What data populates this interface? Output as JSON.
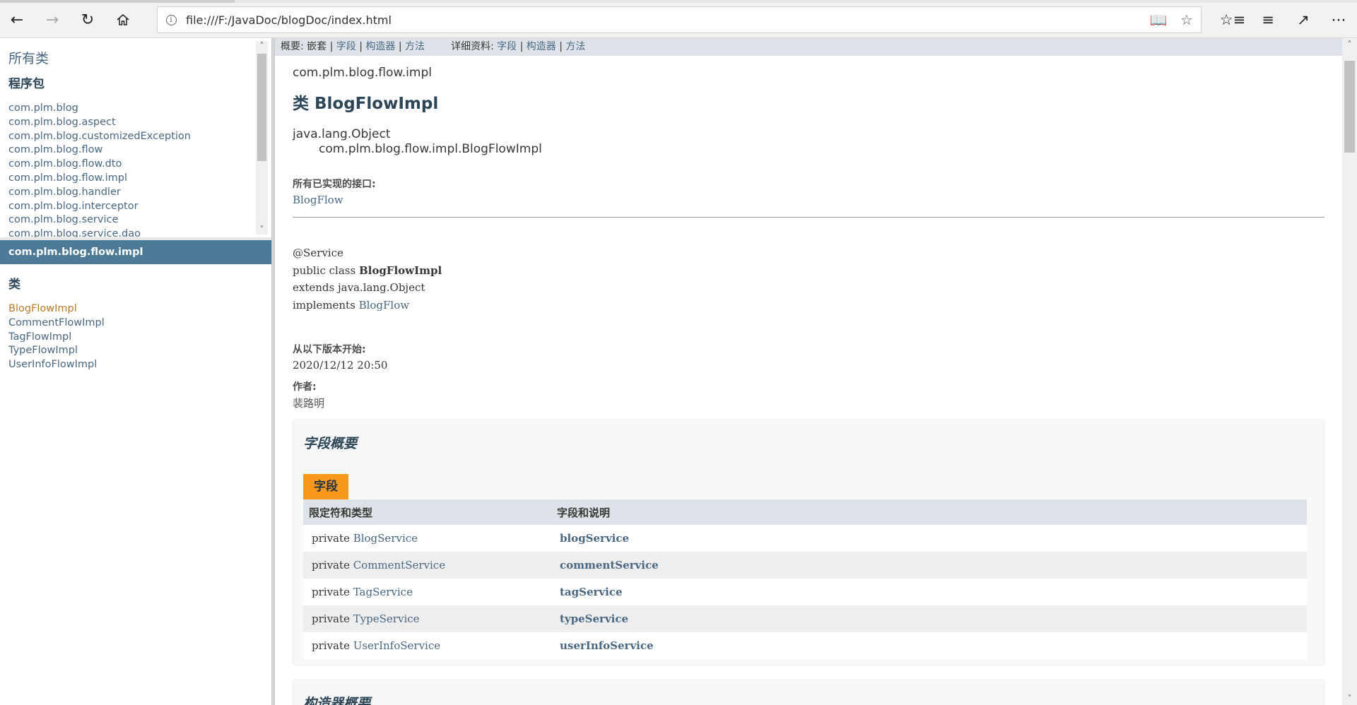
{
  "browser": {
    "url": "file:///F:/JavaDoc/blogDoc/index.html"
  },
  "package_frame": {
    "all_classes_link": "所有类",
    "heading": "程序包",
    "packages": [
      "com.plm.blog",
      "com.plm.blog.aspect",
      "com.plm.blog.customizedException",
      "com.plm.blog.flow",
      "com.plm.blog.flow.dto",
      "com.plm.blog.flow.impl",
      "com.plm.blog.handler",
      "com.plm.blog.interceptor",
      "com.plm.blog.service",
      "com.plm.blog.service.dao"
    ]
  },
  "class_frame": {
    "package_name": "com.plm.blog.flow.impl",
    "heading": "类",
    "classes": [
      "BlogFlowImpl",
      "CommentFlowImpl",
      "TagFlowImpl",
      "TypeFlowImpl",
      "UserInfoFlowImpl"
    ],
    "active_class": "BlogFlowImpl"
  },
  "subnav": {
    "summary_label": "概要:",
    "nested": "嵌套",
    "sep": "|",
    "field": "字段",
    "constructor": "构造器",
    "method": "方法",
    "detail_label": "详细资料:"
  },
  "content": {
    "package_name": "com.plm.blog.flow.impl",
    "class_title": "类 BlogFlowImpl",
    "inheritance_parent": "java.lang.Object",
    "inheritance_child": "com.plm.blog.flow.impl.BlogFlowImpl",
    "interfaces_label": "所有已实现的接口:",
    "interfaces_value": "BlogFlow",
    "signature": {
      "annotation": "@Service",
      "decl_prefix": "public class ",
      "class_name": "BlogFlowImpl",
      "extends_line": "extends java.lang.Object",
      "implements_prefix": "implements ",
      "implements_value": "BlogFlow"
    },
    "since_label": "从以下版本开始:",
    "since_value": "2020/12/12 20:50",
    "author_label": "作者:",
    "author_value": "裴路明",
    "field_summary": {
      "title": "字段概要",
      "caption": "字段",
      "columns": [
        "限定符和类型",
        "字段和说明"
      ],
      "rows": [
        {
          "modifier": "private",
          "type": "BlogService",
          "name": "blogService"
        },
        {
          "modifier": "private",
          "type": "CommentService",
          "name": "commentService"
        },
        {
          "modifier": "private",
          "type": "TagService",
          "name": "tagService"
        },
        {
          "modifier": "private",
          "type": "TypeService",
          "name": "typeService"
        },
        {
          "modifier": "private",
          "type": "UserInfoService",
          "name": "userInfoService"
        }
      ]
    },
    "constructor_summary": {
      "title": "构造器概要"
    }
  },
  "colors": {
    "link": "#4a6782",
    "nav_bar": "#4d7a97",
    "subnav_bg": "#dee3e9",
    "caption_orange": "#f8981d",
    "active_link": "#bb7a2a"
  }
}
